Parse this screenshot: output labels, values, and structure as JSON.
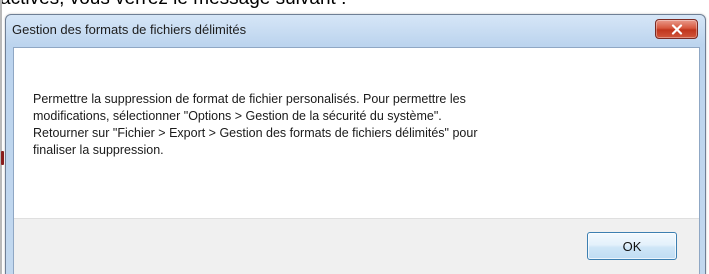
{
  "background": {
    "partial_text": "activés, vous verrez le message suivant :"
  },
  "dialog": {
    "title": "Gestion des formats de fichiers délimités",
    "close_icon": "close-icon",
    "message_lines": [
      "Permettre la suppression de format de fichier personalisés. Pour permettre les",
      "modifications, sélectionner \"Options > Gestion de la sécurité du système\".",
      "Retourner sur \"Fichier > Export > Gestion des formats de fichiers délimités\" pour",
      "finaliser la suppression."
    ],
    "ok_label": "OK"
  },
  "colors": {
    "frame": "#bcd4ee",
    "close_button": "#c0351d",
    "ok_border": "#3c7fb1",
    "footer": "#f0f0f0"
  }
}
